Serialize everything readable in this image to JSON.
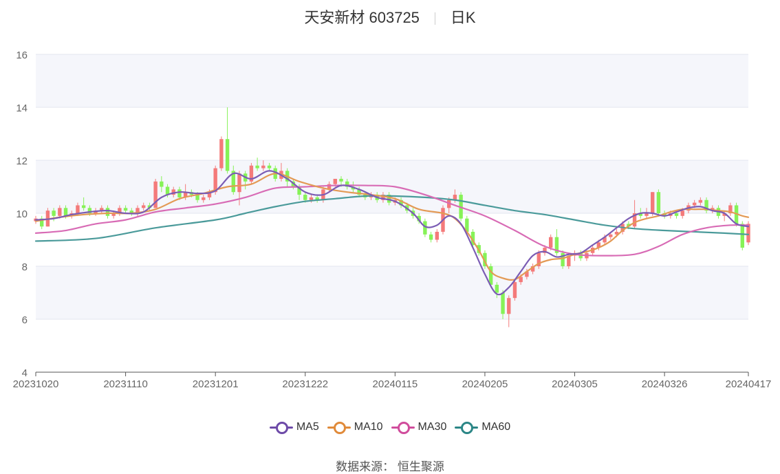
{
  "title": {
    "name": "天安新材 603725",
    "period": "日K"
  },
  "source": "数据来源： 恒生聚源",
  "colors": {
    "up": "#f47a7a",
    "down": "#86f257",
    "ma5": "#7b5cb4",
    "ma10": "#e39a55",
    "ma30": "#d86bb5",
    "ma60": "#4a9a9a",
    "band": "#f5f6fb",
    "grid": "#e3e6ef"
  },
  "legend": [
    {
      "label": "MA5",
      "color": "#6d4aa8"
    },
    {
      "label": "MA10",
      "color": "#e08a3a"
    },
    {
      "label": "MA30",
      "color": "#d04c9c"
    },
    {
      "label": "MA60",
      "color": "#2b8686"
    }
  ],
  "chart_data": {
    "type": "candlestick",
    "ylim": [
      4,
      16
    ],
    "yticks": [
      "4",
      "6",
      "8",
      "10",
      "12",
      "14",
      "16"
    ],
    "xticks": [
      {
        "label": "20231020",
        "index": 0
      },
      {
        "label": "20231110",
        "index": 15
      },
      {
        "label": "20231201",
        "index": 30
      },
      {
        "label": "20231222",
        "index": 45
      },
      {
        "label": "20240115",
        "index": 60
      },
      {
        "label": "20240205",
        "index": 75
      },
      {
        "label": "20240305",
        "index": 90
      },
      {
        "label": "20240326",
        "index": 105
      },
      {
        "label": "20240417",
        "index": 119
      }
    ],
    "candles": [
      [
        9.7,
        9.8,
        9.9,
        9.6
      ],
      [
        9.8,
        9.5,
        9.9,
        9.4
      ],
      [
        9.5,
        10.1,
        10.2,
        9.5
      ],
      [
        10.1,
        9.9,
        10.2,
        9.7
      ],
      [
        9.9,
        10.2,
        10.3,
        9.8
      ],
      [
        10.2,
        9.9,
        10.3,
        9.8
      ],
      [
        9.9,
        10.0,
        10.1,
        9.8
      ],
      [
        10.0,
        10.3,
        10.4,
        9.9
      ],
      [
        10.3,
        10.2,
        10.6,
        10.1
      ],
      [
        10.2,
        10.0,
        10.3,
        9.9
      ],
      [
        10.0,
        10.1,
        10.2,
        9.9
      ],
      [
        10.1,
        10.2,
        10.3,
        10.0
      ],
      [
        10.2,
        9.9,
        10.3,
        9.8
      ],
      [
        9.9,
        10.0,
        10.1,
        9.8
      ],
      [
        10.0,
        10.2,
        10.3,
        9.9
      ],
      [
        10.2,
        10.1,
        10.3,
        10.0
      ],
      [
        10.1,
        10.0,
        10.2,
        9.9
      ],
      [
        10.0,
        10.2,
        10.3,
        9.9
      ],
      [
        10.2,
        10.3,
        10.4,
        10.1
      ],
      [
        10.3,
        10.2,
        10.4,
        10.1
      ],
      [
        10.2,
        11.2,
        11.3,
        10.2
      ],
      [
        11.2,
        11.0,
        11.4,
        10.8
      ],
      [
        11.0,
        10.7,
        11.1,
        10.6
      ],
      [
        10.7,
        10.9,
        11.0,
        10.6
      ],
      [
        10.9,
        10.6,
        11.0,
        10.5
      ],
      [
        10.6,
        10.8,
        11.1,
        10.5
      ],
      [
        10.8,
        10.7,
        10.9,
        10.6
      ],
      [
        10.7,
        10.5,
        10.8,
        10.4
      ],
      [
        10.5,
        10.6,
        10.7,
        10.4
      ],
      [
        10.6,
        10.8,
        10.9,
        10.5
      ],
      [
        10.8,
        11.7,
        11.8,
        10.7
      ],
      [
        11.7,
        12.8,
        12.9,
        11.6
      ],
      [
        12.8,
        11.6,
        14.0,
        11.5
      ],
      [
        11.6,
        10.8,
        11.8,
        10.7
      ],
      [
        10.8,
        11.5,
        11.6,
        10.3
      ],
      [
        11.5,
        11.2,
        11.6,
        10.9
      ],
      [
        11.2,
        11.8,
        11.9,
        11.1
      ],
      [
        11.8,
        11.7,
        12.1,
        11.6
      ],
      [
        11.7,
        11.8,
        12.0,
        11.6
      ],
      [
        11.8,
        11.7,
        11.9,
        11.6
      ],
      [
        11.7,
        11.3,
        11.8,
        11.2
      ],
      [
        11.3,
        11.6,
        11.9,
        11.2
      ],
      [
        11.6,
        11.2,
        11.7,
        11.0
      ],
      [
        11.2,
        11.0,
        11.3,
        10.9
      ],
      [
        11.0,
        10.7,
        11.1,
        10.5
      ],
      [
        10.7,
        10.5,
        10.8,
        10.4
      ],
      [
        10.5,
        10.6,
        10.7,
        10.4
      ],
      [
        10.6,
        10.5,
        10.7,
        10.4
      ],
      [
        10.5,
        10.9,
        11.0,
        10.4
      ],
      [
        10.9,
        11.1,
        11.2,
        10.8
      ],
      [
        11.1,
        11.3,
        11.3,
        11.0
      ],
      [
        11.3,
        11.2,
        11.4,
        11.0
      ],
      [
        11.2,
        11.0,
        11.3,
        10.9
      ],
      [
        11.0,
        10.9,
        11.2,
        10.8
      ],
      [
        10.9,
        10.7,
        11.0,
        10.6
      ],
      [
        10.7,
        10.6,
        10.8,
        10.5
      ],
      [
        10.6,
        10.7,
        10.8,
        10.5
      ],
      [
        10.7,
        10.5,
        10.8,
        10.4
      ],
      [
        10.5,
        10.7,
        10.8,
        10.4
      ],
      [
        10.7,
        10.4,
        10.8,
        10.3
      ],
      [
        10.4,
        10.5,
        10.6,
        10.3
      ],
      [
        10.5,
        10.3,
        10.6,
        10.2
      ],
      [
        10.3,
        10.1,
        10.4,
        10.0
      ],
      [
        10.1,
        9.9,
        10.2,
        9.8
      ],
      [
        9.9,
        9.7,
        10.0,
        9.6
      ],
      [
        9.7,
        9.2,
        9.8,
        9.1
      ],
      [
        9.2,
        9.0,
        9.3,
        8.9
      ],
      [
        9.0,
        9.3,
        9.4,
        8.9
      ],
      [
        9.3,
        10.2,
        10.3,
        9.2
      ],
      [
        10.2,
        10.5,
        10.6,
        10.0
      ],
      [
        10.5,
        10.7,
        10.9,
        10.4
      ],
      [
        10.7,
        9.8,
        10.8,
        9.7
      ],
      [
        9.8,
        9.3,
        9.9,
        9.2
      ],
      [
        9.3,
        8.8,
        9.4,
        8.7
      ],
      [
        8.8,
        8.5,
        8.9,
        8.4
      ],
      [
        8.5,
        8.0,
        8.6,
        7.9
      ],
      [
        8.0,
        7.3,
        8.1,
        7.2
      ],
      [
        7.3,
        7.0,
        7.4,
        6.8
      ],
      [
        7.0,
        6.2,
        7.1,
        6.0
      ],
      [
        6.2,
        6.8,
        6.9,
        5.7
      ],
      [
        6.8,
        7.4,
        7.5,
        6.7
      ],
      [
        7.4,
        7.6,
        7.7,
        7.3
      ],
      [
        7.6,
        7.8,
        7.9,
        7.5
      ],
      [
        7.8,
        8.0,
        8.1,
        7.7
      ],
      [
        8.0,
        8.5,
        8.6,
        7.9
      ],
      [
        8.5,
        8.7,
        8.8,
        8.4
      ],
      [
        8.7,
        9.1,
        9.2,
        8.6
      ],
      [
        9.1,
        8.5,
        9.4,
        8.4
      ],
      [
        8.5,
        8.0,
        8.6,
        7.9
      ],
      [
        8.0,
        8.4,
        8.5,
        7.9
      ],
      [
        8.4,
        8.5,
        8.6,
        8.2
      ],
      [
        8.5,
        8.3,
        8.6,
        8.2
      ],
      [
        8.3,
        8.5,
        8.6,
        8.2
      ],
      [
        8.5,
        8.7,
        8.8,
        8.4
      ],
      [
        8.7,
        8.9,
        9.0,
        8.6
      ],
      [
        8.9,
        9.1,
        9.2,
        8.8
      ],
      [
        9.1,
        9.2,
        9.3,
        9.0
      ],
      [
        9.2,
        9.3,
        9.4,
        9.1
      ],
      [
        9.3,
        9.6,
        9.7,
        9.2
      ],
      [
        9.6,
        9.5,
        9.7,
        9.4
      ],
      [
        9.5,
        10.0,
        10.5,
        9.4
      ],
      [
        10.0,
        9.9,
        10.2,
        9.8
      ],
      [
        9.9,
        10.0,
        10.2,
        9.8
      ],
      [
        10.0,
        10.8,
        10.8,
        9.9
      ],
      [
        10.8,
        10.0,
        10.9,
        9.9
      ],
      [
        10.0,
        9.9,
        10.1,
        9.8
      ],
      [
        9.9,
        10.0,
        10.1,
        9.8
      ],
      [
        10.0,
        9.9,
        10.1,
        9.8
      ],
      [
        9.9,
        10.1,
        10.2,
        9.8
      ],
      [
        10.1,
        10.3,
        10.4,
        10.0
      ],
      [
        10.3,
        10.4,
        10.5,
        10.2
      ],
      [
        10.4,
        10.5,
        10.6,
        10.3
      ],
      [
        10.5,
        10.1,
        10.6,
        10.0
      ],
      [
        10.1,
        10.2,
        10.3,
        10.0
      ],
      [
        10.2,
        9.9,
        10.3,
        9.8
      ],
      [
        9.9,
        10.0,
        10.1,
        9.7
      ],
      [
        10.0,
        10.3,
        10.4,
        9.9
      ],
      [
        10.3,
        9.6,
        10.4,
        9.5
      ],
      [
        9.6,
        8.7,
        9.7,
        8.6
      ],
      [
        8.9,
        9.6,
        9.7,
        8.8
      ]
    ],
    "ma": {
      "MA5": [
        [
          0,
          9.75
        ],
        [
          3,
          9.8
        ],
        [
          6,
          9.95
        ],
        [
          9,
          10.05
        ],
        [
          12,
          10.1
        ],
        [
          15,
          10.0
        ],
        [
          18,
          10.05
        ],
        [
          21,
          10.6
        ],
        [
          24,
          10.8
        ],
        [
          27,
          10.75
        ],
        [
          30,
          10.85
        ],
        [
          33,
          11.5
        ],
        [
          36,
          11.3
        ],
        [
          39,
          11.6
        ],
        [
          42,
          11.3
        ],
        [
          45,
          10.8
        ],
        [
          48,
          10.7
        ],
        [
          51,
          11.05
        ],
        [
          54,
          10.9
        ],
        [
          57,
          10.6
        ],
        [
          60,
          10.45
        ],
        [
          63,
          10.0
        ],
        [
          65,
          9.5
        ],
        [
          67,
          9.55
        ],
        [
          69,
          9.9
        ],
        [
          71,
          9.6
        ],
        [
          73,
          8.7
        ],
        [
          75,
          7.7
        ],
        [
          77,
          6.95
        ],
        [
          79,
          7.2
        ],
        [
          81,
          7.8
        ],
        [
          83,
          8.4
        ],
        [
          85,
          8.55
        ],
        [
          87,
          8.35
        ],
        [
          89,
          8.45
        ],
        [
          91,
          8.5
        ],
        [
          93,
          8.8
        ],
        [
          95,
          9.1
        ],
        [
          97,
          9.45
        ],
        [
          99,
          9.8
        ],
        [
          101,
          10.0
        ],
        [
          103,
          10.0
        ],
        [
          105,
          9.9
        ],
        [
          107,
          10.05
        ],
        [
          109,
          10.2
        ],
        [
          111,
          10.25
        ],
        [
          113,
          10.1
        ],
        [
          115,
          10.0
        ],
        [
          117,
          9.6
        ],
        [
          119,
          9.5
        ]
      ],
      "MA10": [
        [
          0,
          9.7
        ],
        [
          4,
          9.85
        ],
        [
          8,
          9.95
        ],
        [
          12,
          10.0
        ],
        [
          16,
          10.0
        ],
        [
          20,
          10.15
        ],
        [
          24,
          10.55
        ],
        [
          28,
          10.75
        ],
        [
          32,
          11.0
        ],
        [
          36,
          11.1
        ],
        [
          40,
          11.5
        ],
        [
          44,
          11.2
        ],
        [
          48,
          10.95
        ],
        [
          52,
          10.8
        ],
        [
          56,
          10.7
        ],
        [
          60,
          10.55
        ],
        [
          64,
          10.15
        ],
        [
          68,
          10.0
        ],
        [
          70,
          9.8
        ],
        [
          72,
          9.3
        ],
        [
          74,
          8.6
        ],
        [
          76,
          7.8
        ],
        [
          78,
          7.55
        ],
        [
          80,
          7.5
        ],
        [
          82,
          7.8
        ],
        [
          84,
          8.1
        ],
        [
          86,
          8.25
        ],
        [
          88,
          8.3
        ],
        [
          90,
          8.45
        ],
        [
          92,
          8.55
        ],
        [
          94,
          8.7
        ],
        [
          96,
          8.95
        ],
        [
          98,
          9.35
        ],
        [
          100,
          9.65
        ],
        [
          102,
          9.8
        ],
        [
          104,
          9.9
        ],
        [
          106,
          10.05
        ],
        [
          108,
          10.15
        ],
        [
          110,
          10.15
        ],
        [
          112,
          10.15
        ],
        [
          114,
          10.1
        ],
        [
          116,
          10.05
        ],
        [
          118,
          9.9
        ],
        [
          119,
          9.85
        ]
      ],
      "MA30": [
        [
          0,
          9.25
        ],
        [
          5,
          9.35
        ],
        [
          10,
          9.6
        ],
        [
          15,
          9.75
        ],
        [
          20,
          10.05
        ],
        [
          25,
          10.2
        ],
        [
          30,
          10.35
        ],
        [
          35,
          10.6
        ],
        [
          40,
          10.95
        ],
        [
          45,
          11.0
        ],
        [
          50,
          11.05
        ],
        [
          55,
          11.05
        ],
        [
          60,
          11.0
        ],
        [
          65,
          10.7
        ],
        [
          70,
          10.3
        ],
        [
          75,
          9.9
        ],
        [
          80,
          9.35
        ],
        [
          85,
          8.75
        ],
        [
          90,
          8.45
        ],
        [
          95,
          8.4
        ],
        [
          100,
          8.45
        ],
        [
          104,
          8.75
        ],
        [
          108,
          9.2
        ],
        [
          112,
          9.45
        ],
        [
          116,
          9.55
        ],
        [
          119,
          9.55
        ]
      ],
      "MA60": [
        [
          0,
          8.95
        ],
        [
          10,
          9.05
        ],
        [
          20,
          9.45
        ],
        [
          30,
          9.75
        ],
        [
          35,
          10.0
        ],
        [
          40,
          10.25
        ],
        [
          45,
          10.45
        ],
        [
          50,
          10.55
        ],
        [
          55,
          10.65
        ],
        [
          60,
          10.65
        ],
        [
          65,
          10.6
        ],
        [
          70,
          10.5
        ],
        [
          75,
          10.3
        ],
        [
          80,
          10.1
        ],
        [
          85,
          9.95
        ],
        [
          90,
          9.75
        ],
        [
          95,
          9.55
        ],
        [
          100,
          9.42
        ],
        [
          105,
          9.35
        ],
        [
          110,
          9.3
        ],
        [
          115,
          9.25
        ],
        [
          119,
          9.2
        ]
      ]
    }
  }
}
